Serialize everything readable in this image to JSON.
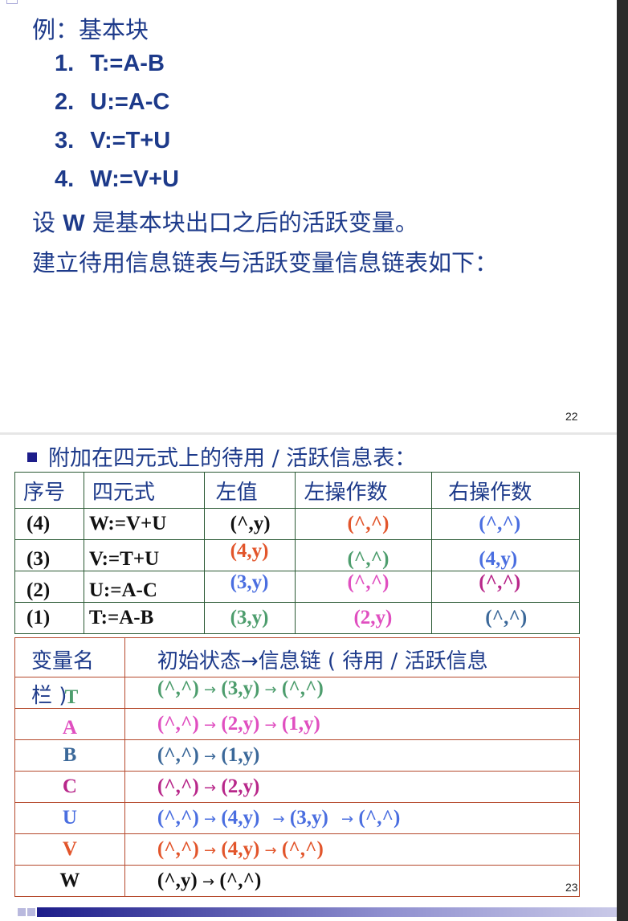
{
  "slide1": {
    "heading": "例：基本块",
    "steps": [
      {
        "num": "1.",
        "code": "T:=A-B"
      },
      {
        "num": "2.",
        "code": "U:=A-C"
      },
      {
        "num": "3.",
        "code": "V:=T+U"
      },
      {
        "num": "4.",
        "code": "W:=V+U"
      }
    ],
    "note_pre": "设 ",
    "note_var": "W",
    "note_post": " 是基本块出口之后的活跃变量。",
    "note2": "建立待用信息链表与活跃变量信息链表如下：",
    "page_number": "22"
  },
  "slide2": {
    "title": "附加在四元式上的待用 / 活跃信息表：",
    "table1": {
      "headers": [
        "序号",
        "四元式",
        "左值",
        "左操作数",
        "右操作数"
      ],
      "rows": [
        {
          "seq": "(4)",
          "quad": "W:=V+U",
          "left": "(^,y)",
          "lop": "(^,^)",
          "rop": "(^,^)"
        },
        {
          "seq": "(3)",
          "quad": "V:=T+U",
          "left": "(4,y)",
          "lop": "(^,^)",
          "rop": "(4,y)"
        },
        {
          "seq": "(2)",
          "quad": "U:=A-C",
          "left": "(3,y)",
          "lop": "(^,^)",
          "rop": "(^,^)"
        },
        {
          "seq": "(1)",
          "quad": "T:=A-B",
          "left": "(3,y)",
          "lop": "(2,y)",
          "rop": "(^,^)"
        }
      ]
    },
    "table2": {
      "header_var": "变量名",
      "header_chain": "初始状态→信息链 ( 待用 / 活跃信息",
      "header_overflow": "栏 )",
      "arrow": "→",
      "rows": [
        {
          "var": "T",
          "chain": [
            "(^,^)",
            "(3,y)",
            "(^,^)"
          ]
        },
        {
          "var": "A",
          "chain": [
            "(^,^)",
            "(2,y)",
            "(1,y)"
          ]
        },
        {
          "var": "B",
          "chain": [
            "(^,^)",
            "(1,y)"
          ]
        },
        {
          "var": "C",
          "chain": [
            "(^,^)",
            "(2,y)"
          ]
        },
        {
          "var": "U",
          "chain": [
            "(^,^)",
            "(4,y)",
            "(3,y)",
            "(^,^)"
          ]
        },
        {
          "var": "V",
          "chain": [
            "(^,^)",
            "(4,y)",
            "(^,^)"
          ]
        },
        {
          "var": "W",
          "chain": [
            "(^,y)",
            "(^,^)"
          ]
        }
      ]
    },
    "page_number": "23"
  }
}
